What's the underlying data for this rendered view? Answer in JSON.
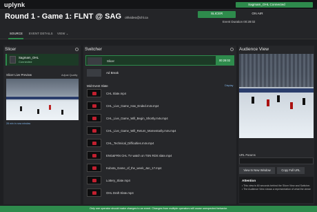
{
  "app": {
    "logo": "uplynk"
  },
  "status": {
    "text": "Sagmam_OHL Connected"
  },
  "header": {
    "title": "Round 1 - Game 1: FLNT @ SAG",
    "account": "ohlvideo@chl.ca",
    "slicer_button": "SLICER",
    "onair_button": "ON AIR",
    "duration": "Event Duration 00:28:02"
  },
  "tabs": [
    "SOURCE",
    "EVENT DETAILS",
    "VIEW ⌄"
  ],
  "slicer_panel": {
    "title": "Slicer",
    "card_name": "Sagmam_OHL",
    "card_status": "Connected",
    "preview_label": "Slicer Live Preview",
    "adjust_quality": "Adjust Quality",
    "preview_time": "28 min in now window"
  },
  "switcher_panel": {
    "title": "Switcher",
    "slicer_row": "Slicer",
    "timer": "00:28:02",
    "ad_break": "Ad Break",
    "slate_title": "Mid Event Slate",
    "display_link": "Display",
    "slates": [
      "CHL Slate.mp4",
      "CHL_Live_Game_Has_Ended.m4v.mp4",
      "CHL_Live_Game_Will_Begin_Shortly.m4v.mp4",
      "CHL_Live_Game_Will_Return_Momentarily.m4v.mp4",
      "CHL_Technical_Difficulties.m4v.mp4",
      "ENG&FRN CHL TV watch on TSN RDS slate.mp4",
      "Kubota_Game_of_the_week_Jan_17.mp4",
      "Lottery_Slate.mp4",
      "OHL Draft Slate.mp4"
    ]
  },
  "audience_panel": {
    "title": "Audience View",
    "url_label": "URL Params",
    "new_window_button": "View In New Window",
    "copy_button": "Copy Full URL",
    "attention_title": "Attention",
    "attention_lines": [
      "• This view is 60 seconds behind the Slicer View and Switcher.",
      "• The Audience View shows a representation of what the viewer"
    ]
  },
  "footer": {
    "text": "Only one operator should make changes to an event. Changes from multiple operators will cause unexpected behavior."
  },
  "colors": {
    "accent": "#2e8b4c",
    "background": "#1e1f22",
    "panel": "#26272a"
  }
}
